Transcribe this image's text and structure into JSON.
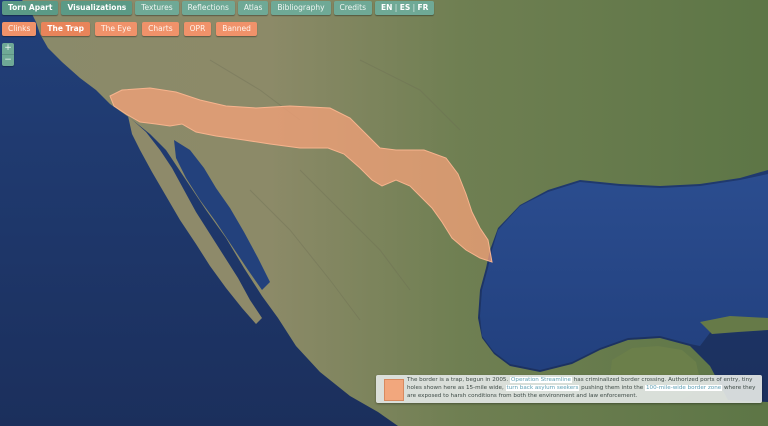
{
  "nav": {
    "items": [
      {
        "label": "Torn Apart",
        "strong": true
      },
      {
        "label": "Visualizations",
        "strong": true
      },
      {
        "label": "Textures"
      },
      {
        "label": "Reflections"
      },
      {
        "label": "Atlas"
      },
      {
        "label": "Bibliography"
      },
      {
        "label": "Credits"
      }
    ],
    "lang": {
      "en": "EN",
      "es": "ES",
      "fr": "FR"
    }
  },
  "subnav": {
    "items": [
      {
        "label": "Clinks"
      },
      {
        "label": "The Trap",
        "active": true
      },
      {
        "label": "The Eye"
      },
      {
        "label": "Charts"
      },
      {
        "label": "OPR"
      },
      {
        "label": "Banned"
      }
    ]
  },
  "zoom": {
    "in": "+",
    "out": "−"
  },
  "info": {
    "swatch_color": "#f2a77d",
    "text_1": "The border is a trap, begun in 2005.",
    "link_1": "Operation Streamline",
    "text_2": "has criminalized border crossing. Authorized ports of entry, tiny holes shown here as 15-mile wide,",
    "link_2": "turn back asylum seekers",
    "text_3": "pushing them into the",
    "link_3": "100-mile-wide border zone",
    "text_4": "where they are exposed to harsh conditions from both the environment and law enforcement."
  },
  "colors": {
    "nav": "#6fa996",
    "subnav": "#f0926a",
    "trap_fill": "#f5a27a"
  }
}
